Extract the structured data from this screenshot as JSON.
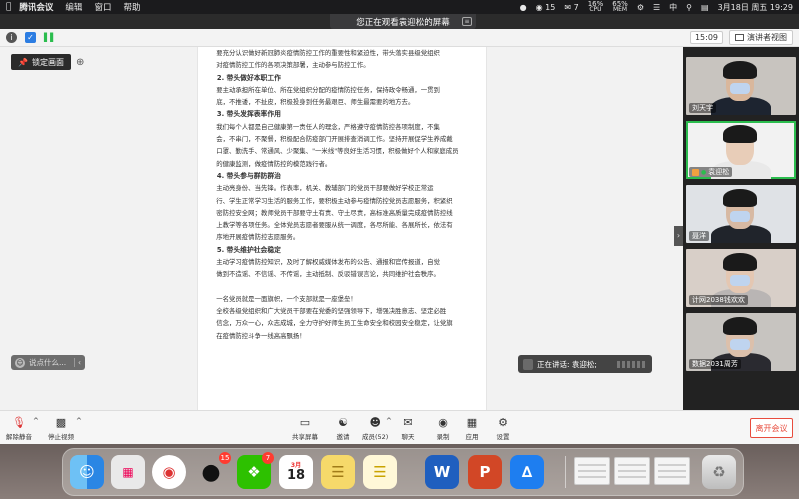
{
  "menubar": {
    "app_name": "腾讯会议",
    "menus": [
      "编辑",
      "窗口",
      "帮助"
    ],
    "status": {
      "notif_count": "15",
      "chat_count": "7",
      "cpu_value": "16%",
      "cpu_label": "CPU",
      "mem_value": "65%",
      "mem_label": "MEM",
      "input_method": "中",
      "datetime": "3月18日 周五 19:29"
    }
  },
  "share_banner": {
    "text": "您正在观看袁迎松的屏幕"
  },
  "topbar": {
    "timer": "15:09",
    "view_label": "演讲者视图"
  },
  "lock_button": {
    "label": "锁定画面"
  },
  "document": {
    "blocks": [
      {
        "type": "p",
        "text": "要充分认识做好新冠肺炎疫情防控工作的重要性和紧迫性，带头落实县级党组织"
      },
      {
        "type": "p",
        "text": "对疫情防控工作的各项决策部署，主动参与防控工作。"
      },
      {
        "type": "h",
        "text": "2. 带头做好本职工作"
      },
      {
        "type": "p",
        "text": "要主动承担所在单位、所在党组织分配的疫情防控任务，保持政令畅通，一贯到"
      },
      {
        "type": "p",
        "text": "底，不推诿，不扯皮，积极投身到任务最艰巨、师生最需要的地方去。"
      },
      {
        "type": "h",
        "text": "3. 带头发挥表率作用"
      },
      {
        "type": "p",
        "text": "我们每个人都是自己健康第一责任人的理念，严格遵守疫情防控各项制度，不集"
      },
      {
        "type": "p",
        "text": "会，不串门，不聚餐，积极配合防疫部门开展排查消调工作。坚持开展促学生养成戴"
      },
      {
        "type": "p",
        "text": "口罩、勤洗手、常通风、少聚集、\"一米线\"等良好生活习惯，积极做好个人和家庭成员"
      },
      {
        "type": "p",
        "text": "的健康监测，做疫情防控的模范践行者。"
      },
      {
        "type": "h",
        "text": "4. 带头参与群防群治"
      },
      {
        "type": "p",
        "text": "主动亮身份、当先锋。作表率，机关、教辅部门的党员干部要做好学校正常运"
      },
      {
        "type": "p",
        "text": "行、学生正常学习生活的服务工作，要积极主动参与疫情防控党员志愿服务，积紧织"
      },
      {
        "type": "p",
        "text": "密防控安全网；教师党员干部要守土有责、守土尽责，高标准高质量完成疫情防控线"
      },
      {
        "type": "p",
        "text": "上教学等各项任务。全体党员志愿者要服从统一调度，各尽所能、各展所长，依法有"
      },
      {
        "type": "p",
        "text": "序地开展疫情防控志愿服务。"
      },
      {
        "type": "h",
        "text": "5. 带头维护社会稳定"
      },
      {
        "type": "p",
        "text": "主动学习疫情防控知识，及时了解权威媒体发布的公告、通报和官传报道，自觉"
      },
      {
        "type": "p",
        "text": "做到不造谣、不信谣、不传谣，主动抵制、反驳错误言论，共同维护社会秩序。"
      },
      {
        "type": "gap",
        "text": ""
      },
      {
        "type": "p",
        "text": "一名党员就是一面旗帜，一个支部就是一座堡垒！"
      },
      {
        "type": "p",
        "text": "全校各级党组织和广大党员干部要在党委的坚强领导下，增强决胜意志、坚定必胜"
      },
      {
        "type": "p",
        "text": "信念，万众一心，众志成城，全力守护好师生员工生命安全和校园安全稳定，让党旗"
      },
      {
        "type": "p",
        "text": "在疫情防控斗争一线高高飘扬！"
      }
    ]
  },
  "chat": {
    "placeholder": "说点什么..."
  },
  "speaking": {
    "label": "正在讲话: 袁迎松;"
  },
  "participants": [
    {
      "name": "刘天宇",
      "skin": "#d9b79c",
      "shirt": "#1d2430",
      "bg": "#c8c4bf",
      "mask": true,
      "active": false,
      "host": false
    },
    {
      "name": "袁迎松",
      "skin": "#e8cdb8",
      "shirt": "#e9e9e9",
      "bg": "#f2f2f2",
      "mask": false,
      "active": true,
      "host": true
    },
    {
      "name": "聂洋",
      "skin": "#d7b9a3",
      "shirt": "#20242b",
      "bg": "#dfe2e6",
      "mask": true,
      "active": false,
      "host": false
    },
    {
      "name": "计网2038钱欢欢",
      "skin": "#e4c7b2",
      "shirt": "#b9b5b4",
      "bg": "#d8cfc8",
      "mask": true,
      "active": false,
      "host": false
    },
    {
      "name": "数据2031周芳",
      "skin": "#dcc0ab",
      "shirt": "#2a2a30",
      "bg": "#c7c4c0",
      "mask": true,
      "active": false,
      "host": false
    }
  ],
  "controls": {
    "mute": "解除静音",
    "video": "停止视频",
    "share": "共享屏幕",
    "invite": "邀请",
    "members": "成员(52)",
    "chat": "聊天",
    "record": "录制",
    "apps": "应用",
    "settings": "设置",
    "leave": "离开会议"
  },
  "dock": {
    "qq_badge": "15",
    "wechat_badge": "7",
    "calendar_month": "3月",
    "calendar_day": "18",
    "word_letter": "W",
    "ppt_letter": "P"
  },
  "colors": {
    "active_speaker": "#2bbd4e",
    "leave": "#e84c3d",
    "badge": "#ff3b30"
  }
}
